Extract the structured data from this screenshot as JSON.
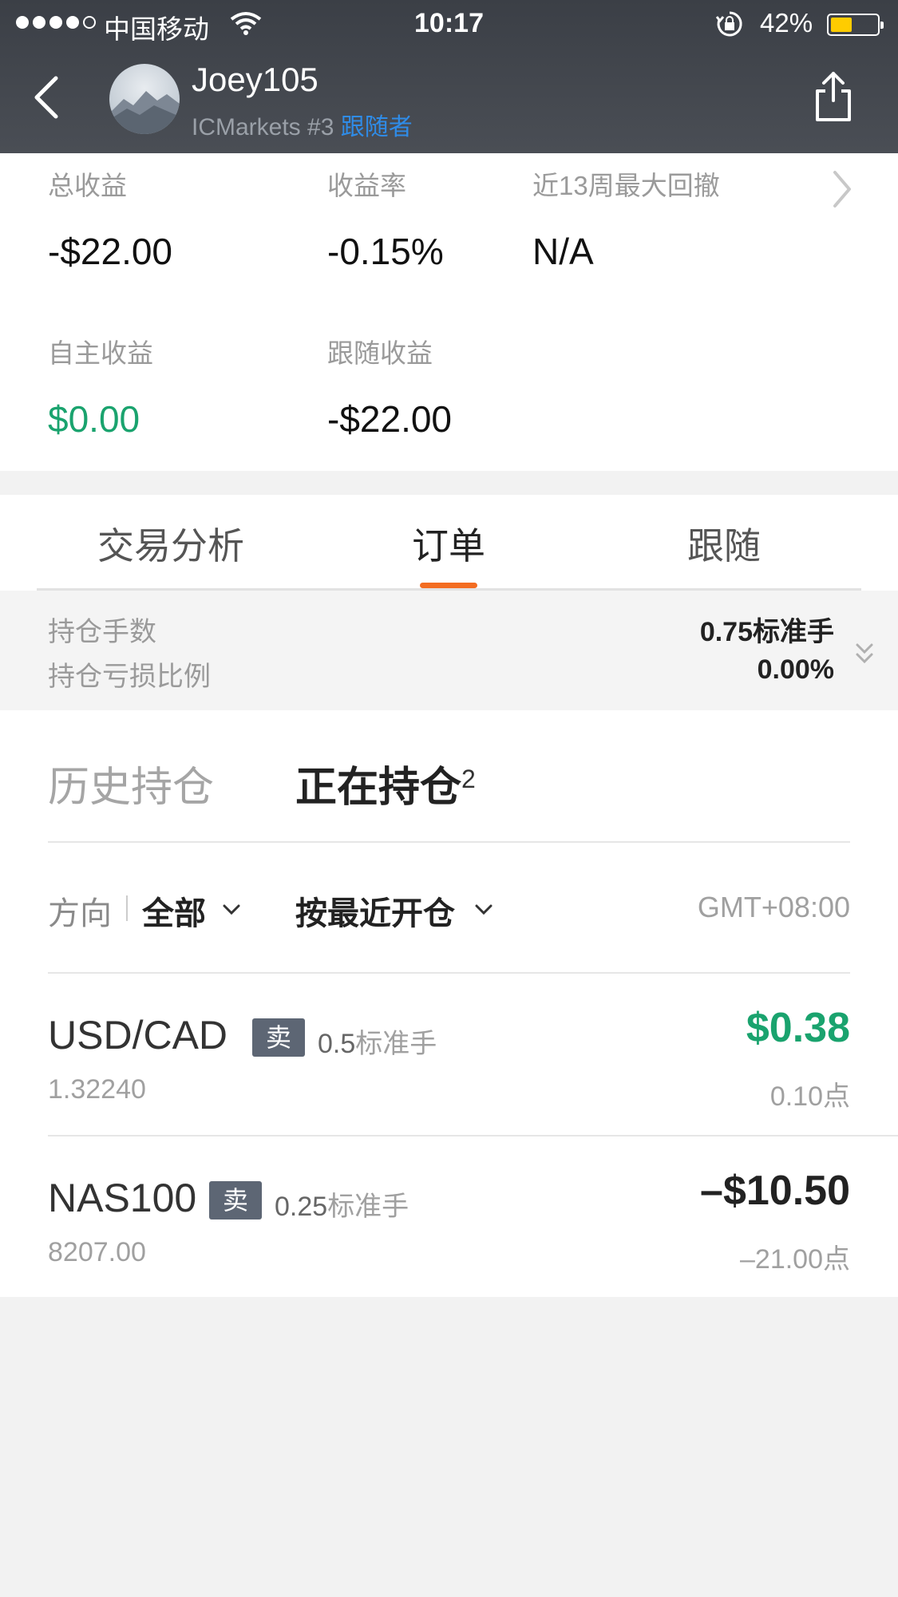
{
  "status_bar": {
    "carrier": "中国移动",
    "time": "10:17",
    "battery": "42%"
  },
  "header": {
    "username": "Joey105",
    "broker": "ICMarkets #3",
    "role": "跟随者"
  },
  "summary": {
    "total_profit_label": "总收益",
    "total_profit_value": "-$22.00",
    "return_rate_label": "收益率",
    "return_rate_value": "-0.15%",
    "drawdown_label": "近13周最大回撤",
    "drawdown_value": "N/A",
    "self_profit_label": "自主收益",
    "self_profit_value": "$0.00",
    "follow_profit_label": "跟随收益",
    "follow_profit_value": "-$22.00"
  },
  "tabs": [
    {
      "label": "交易分析"
    },
    {
      "label": "订单"
    },
    {
      "label": "跟随"
    }
  ],
  "position_summary": {
    "lots_label": "持仓手数",
    "lots_value": "0.75标准手",
    "loss_ratio_label": "持仓亏损比例",
    "loss_ratio_value": "0.00%"
  },
  "orders": {
    "history_tab": "历史持仓",
    "open_tab": "正在持仓",
    "open_count": "2",
    "filter_direction_label": "方向",
    "filter_direction_value": "全部",
    "filter_sort_value": "按最近开仓",
    "timezone": "GMT+08:00",
    "rows": [
      {
        "symbol": "USD/CAD",
        "side": "卖",
        "lots": "0.5",
        "lots_unit": "标准手",
        "price": "1.32240",
        "pnl": "$0.38",
        "points": "0.10点"
      },
      {
        "symbol": "NAS100",
        "side": "卖",
        "lots": "0.25",
        "lots_unit": "标准手",
        "price": "8207.00",
        "pnl": "–$10.50",
        "points": "–21.00点"
      }
    ]
  },
  "colors": {
    "accent_orange": "#f36c21",
    "profit_green": "#1aa36e",
    "role_blue": "#2f8ce8"
  }
}
